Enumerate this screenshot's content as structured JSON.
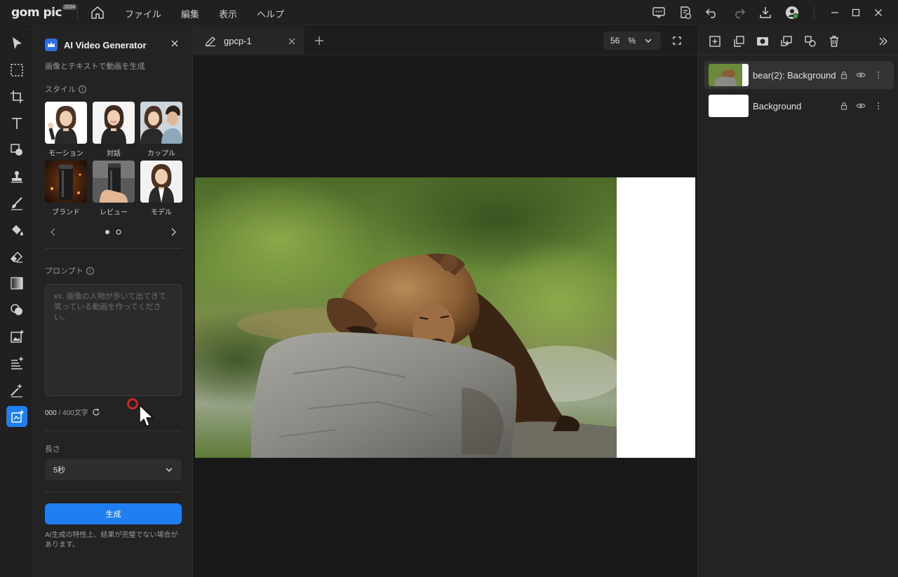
{
  "app": {
    "logo_text": "gom pic",
    "logo_badge": "2024",
    "menu": [
      "ファイル",
      "編集",
      "表示",
      "ヘルプ"
    ]
  },
  "panel": {
    "title": "AI Video Generator",
    "subtitle": "画像とテキストで動画を生成",
    "style_label": "スタイル",
    "styles": [
      {
        "label": "モーション"
      },
      {
        "label": "対話"
      },
      {
        "label": "カップル"
      },
      {
        "label": "ブランド"
      },
      {
        "label": "レビュー"
      },
      {
        "label": "モデル"
      }
    ],
    "carousel": {
      "pages": 2,
      "current": 1
    },
    "prompt_label": "プロンプト",
    "prompt_placeholder": "ex. 画像の人物が歩いて出てきて笑っている動画を作ってください。",
    "char_count": "000",
    "char_limit": "/ 400文字",
    "length_label": "長さ",
    "length_value": "5秒",
    "generate_label": "生成",
    "note": "AI生成の特性上、結果が完璧でない場合があります。"
  },
  "document": {
    "tab_name": "gpcp-1",
    "zoom_value": "56",
    "zoom_unit": "%"
  },
  "layers": [
    {
      "name": "bear(2): Background",
      "selected": true
    },
    {
      "name": "Background",
      "selected": false
    }
  ],
  "colors": {
    "accent": "#1f7ef2",
    "background": "#191919",
    "panel": "#232323"
  }
}
